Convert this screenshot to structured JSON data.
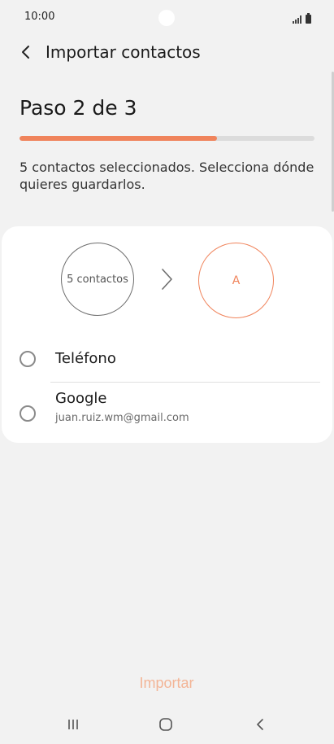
{
  "status_bar": {
    "time": "10:00",
    "signal_icon": "signal-icon",
    "battery_icon": "battery-icon"
  },
  "header": {
    "back_icon": "chevron-left-icon",
    "title": "Importar contactos"
  },
  "step": {
    "title": "Paso 2 de 3",
    "progress_percent": 67,
    "description": "5 contactos seleccionados. Selecciona dónde quieres guardarlos."
  },
  "transfer": {
    "source_label": "5 contactos",
    "arrow_icon": "chevron-right-icon",
    "destination_label": "A"
  },
  "options": [
    {
      "label": "Teléfono",
      "sublabel": ""
    },
    {
      "label": "Google",
      "sublabel": "juan.ruiz.wm@gmail.com"
    }
  ],
  "actions": {
    "import_label": "Importar"
  },
  "nav_bar": {
    "recent_icon": "recent-apps-icon",
    "home_icon": "home-icon",
    "back_icon": "back-icon"
  },
  "colors": {
    "accent": "#f0845c",
    "accent_disabled": "#f3b597",
    "background": "#f2f2f2",
    "card": "#ffffff"
  }
}
